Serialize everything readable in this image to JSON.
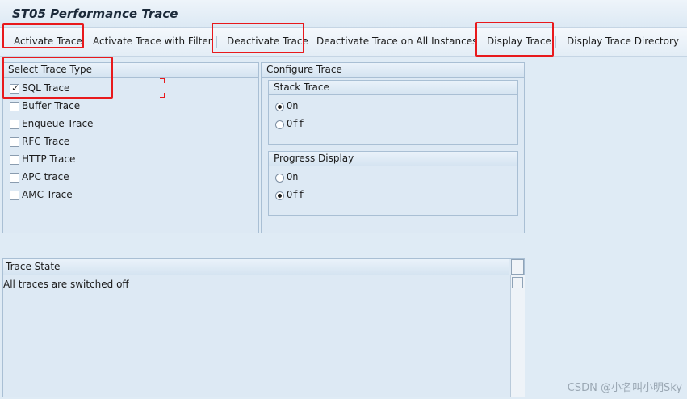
{
  "window": {
    "title": "ST05 Performance Trace"
  },
  "toolbar": {
    "activate_trace": "Activate Trace",
    "activate_trace_filter": "Activate Trace with Filter",
    "deactivate_trace": "Deactivate Trace",
    "deactivate_all": "Deactivate Trace on All Instances",
    "display_trace": "Display Trace",
    "display_trace_directory": "Display Trace Directory"
  },
  "select_trace_type": {
    "title": "Select Trace Type",
    "items": [
      {
        "label": "SQL Trace",
        "checked": true
      },
      {
        "label": "Buffer Trace",
        "checked": false
      },
      {
        "label": "Enqueue Trace",
        "checked": false
      },
      {
        "label": "RFC Trace",
        "checked": false
      },
      {
        "label": "HTTP Trace",
        "checked": false
      },
      {
        "label": "APC trace",
        "checked": false
      },
      {
        "label": "AMC Trace",
        "checked": false
      }
    ]
  },
  "configure_trace": {
    "title": "Configure Trace",
    "stack_trace": {
      "title": "Stack Trace",
      "options": [
        {
          "label": "On",
          "selected": true
        },
        {
          "label": "Off",
          "selected": false
        }
      ]
    },
    "progress_display": {
      "title": "Progress Display",
      "options": [
        {
          "label": "On",
          "selected": false
        },
        {
          "label": "Off",
          "selected": true
        }
      ]
    }
  },
  "trace_state": {
    "title": "Trace State",
    "text": "All traces are switched off"
  },
  "watermark": "CSDN @小名叫小明Sky"
}
